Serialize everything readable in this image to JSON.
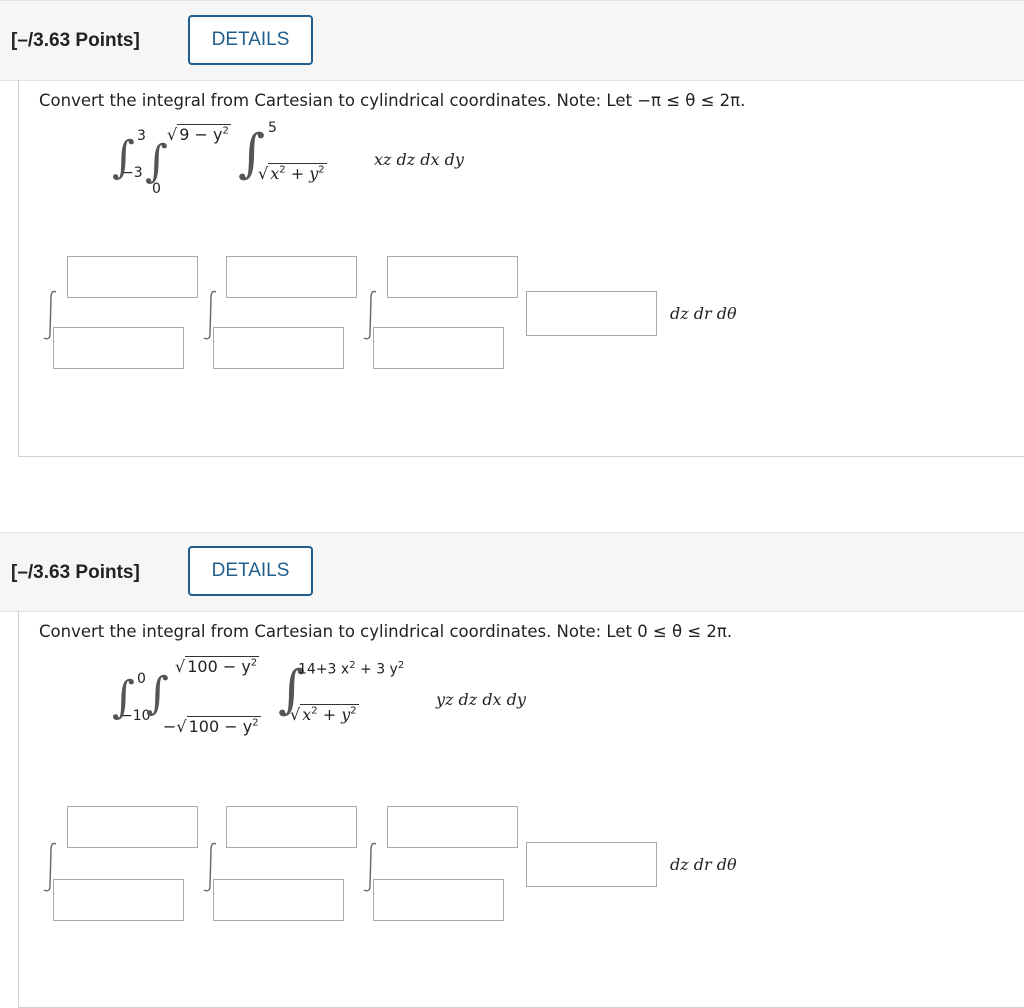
{
  "questions": [
    {
      "points_label": "[–/3.63 Points]",
      "details_label": "DETAILS",
      "prompt": "Convert the integral from Cartesian to cylindrical coordinates. Note: Let −π ≤ θ ≤ 2π.",
      "outer_upper": "3",
      "outer_lower": "−3",
      "middle_lower": "0",
      "middle_upper_radicand": "9 − y",
      "inner_upper": "5",
      "inner_lower_radicand": "x",
      "inner_lower_radicand_b": " + y",
      "exp2": "2",
      "integrand": "xz dz dx dy",
      "answer_differential": "dz dr dθ"
    },
    {
      "points_label": "[–/3.63 Points]",
      "details_label": "DETAILS",
      "prompt": "Convert the integral from Cartesian to cylindrical coordinates. Note: Let 0 ≤ θ ≤ 2π.",
      "outer_upper": "0",
      "outer_lower": "−10",
      "middle_upper_radicand": "100 − y",
      "middle_lower_prefix": "−",
      "middle_lower_radicand": "100 − y",
      "inner_upper": "14+3 x",
      "inner_upper_b": " + 3 y",
      "inner_lower_radicand": "x",
      "inner_lower_radicand_b": " + y",
      "exp2": "2",
      "integrand": "yz dz dx dy",
      "answer_differential": "dz dr dθ"
    }
  ]
}
